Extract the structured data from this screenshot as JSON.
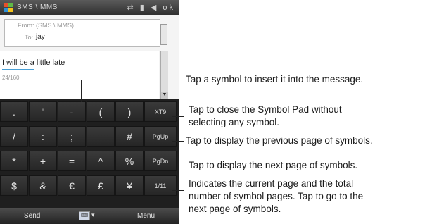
{
  "phone": {
    "app_title": "SMS \\ MMS",
    "status_icons": "⇄ ▮ ◀ ok",
    "from_label": "From: (SMS \\ MMS)",
    "to_label": "To:",
    "to_value": "jay",
    "message_text": "I will be a little late",
    "char_count": "24/160",
    "scroll_down_arrow": "▼",
    "symbol_rows": [
      [
        ".",
        "\"",
        "-",
        "(",
        ")",
        "XT9"
      ],
      [
        "/",
        ":",
        ";",
        "_",
        "#",
        "PgUp"
      ],
      [
        "*",
        "+",
        "=",
        "^",
        "%",
        "PgDn"
      ],
      [
        "$",
        "&",
        "€",
        "£",
        "¥",
        "1/11"
      ]
    ],
    "softkey_left": "Send",
    "softkey_right": "Menu",
    "input_icon": "⌨",
    "input_caret": "▾"
  },
  "callouts": {
    "insert_symbol": "Tap a symbol to insert it into the message.",
    "close_line1": "Tap to close the Symbol Pad without",
    "close_line2": "selecting any symbol.",
    "prev_page": "Tap to display the previous page of symbols.",
    "next_page": "Tap to display the next page of symbols.",
    "page_line1": "Indicates the current page and the total",
    "page_line2": "number of symbol pages. Tap to go to the",
    "page_line3": "next page of symbols."
  }
}
